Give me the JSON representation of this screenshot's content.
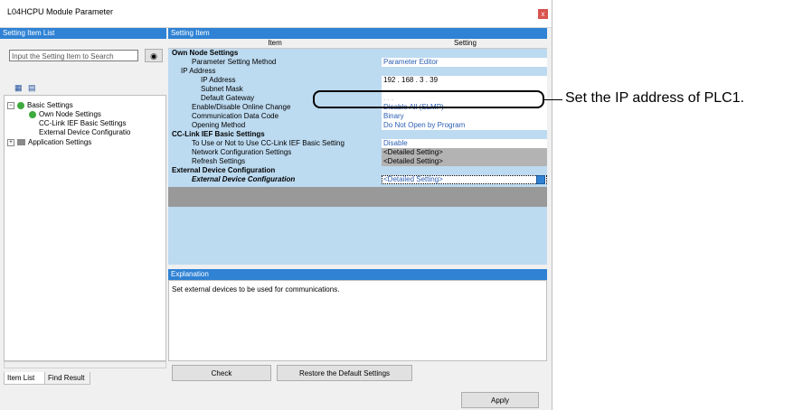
{
  "window": {
    "title": "L04HCPU Module Parameter",
    "close_glyph": "x"
  },
  "left_panel": {
    "header": "Setting Item List",
    "search_placeholder": "Input the Setting Item to Search",
    "tree": [
      {
        "label": "Basic Settings",
        "expanded": true
      },
      {
        "label": "Own Node Settings"
      },
      {
        "label": "CC-Link IEF Basic Settings"
      },
      {
        "label": "External Device Configuratio"
      },
      {
        "label": "Application Settings"
      }
    ],
    "tabs": [
      "Item List",
      "Find Result"
    ]
  },
  "right_panel": {
    "header": "Setting Item",
    "columns": {
      "item": "Item",
      "setting": "Setting"
    },
    "rows": [
      {
        "item": "Own Node Settings",
        "setting": ""
      },
      {
        "item": "Parameter Setting Method",
        "setting": "Parameter Editor"
      },
      {
        "item": "IP Address",
        "setting": ""
      },
      {
        "item": "IP Address",
        "setting": "192 . 168 .   3 .  39"
      },
      {
        "item": "Subnet Mask",
        "setting": ".   .   ."
      },
      {
        "item": "Default Gateway",
        "setting": ".   .   ."
      },
      {
        "item": "Enable/Disable Online Change",
        "setting": "Disable All (SLMP)"
      },
      {
        "item": "Communication Data Code",
        "setting": "Binary"
      },
      {
        "item": "Opening Method",
        "setting": "Do Not Open by Program"
      },
      {
        "item": "CC-Link IEF Basic Settings",
        "setting": ""
      },
      {
        "item": "To Use or Not to Use CC-Link IEF Basic Setting",
        "setting": "Disable"
      },
      {
        "item": "Network Configuration Settings",
        "setting": "<Detailed Setting>"
      },
      {
        "item": "Refresh Settings",
        "setting": "<Detailed Setting>"
      },
      {
        "item": "External Device Configuration",
        "setting": ""
      },
      {
        "item": "External Device Configuration",
        "setting": "<Detailed Setting>"
      }
    ],
    "explanation_header": "Explanation",
    "explanation_text": "Set external devices to be used for communications."
  },
  "buttons": {
    "check": "Check",
    "restore": "Restore the Default Settings",
    "apply": "Apply"
  },
  "callout": "Set the IP address of PLC1.",
  "colors": {
    "accent": "#2f82d4",
    "grid_bg": "#bcdaf0",
    "link_text": "#2b5fb4"
  }
}
